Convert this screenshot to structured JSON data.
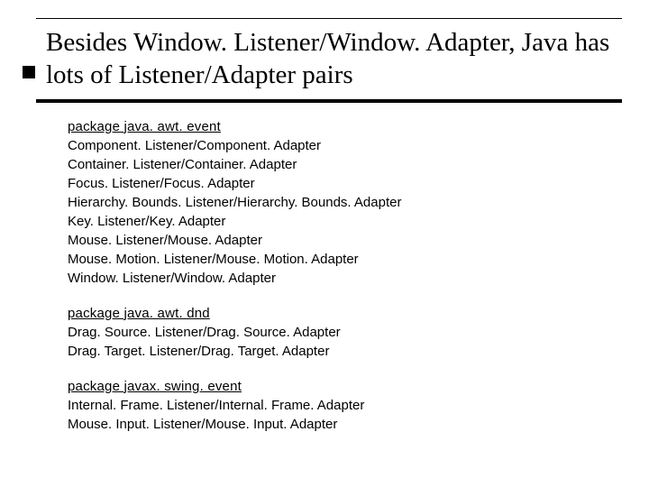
{
  "title": "Besides Window. Listener/Window. Adapter, Java has lots of Listener/Adapter  pairs",
  "packages": [
    {
      "heading": "package java. awt. event",
      "pairs": [
        "Component. Listener/Component. Adapter",
        "Container. Listener/Container. Adapter",
        "Focus. Listener/Focus. Adapter",
        "Hierarchy. Bounds. Listener/Hierarchy. Bounds. Adapter",
        "Key. Listener/Key. Adapter",
        "Mouse. Listener/Mouse. Adapter",
        "Mouse. Motion. Listener/Mouse. Motion. Adapter",
        "Window. Listener/Window. Adapter"
      ]
    },
    {
      "heading": "package java. awt. dnd",
      "pairs": [
        "Drag. Source. Listener/Drag. Source. Adapter",
        "Drag. Target. Listener/Drag. Target. Adapter"
      ]
    },
    {
      "heading": "package javax. swing. event",
      "pairs": [
        "Internal. Frame. Listener/Internal. Frame. Adapter",
        "Mouse. Input. Listener/Mouse. Input. Adapter"
      ]
    }
  ]
}
